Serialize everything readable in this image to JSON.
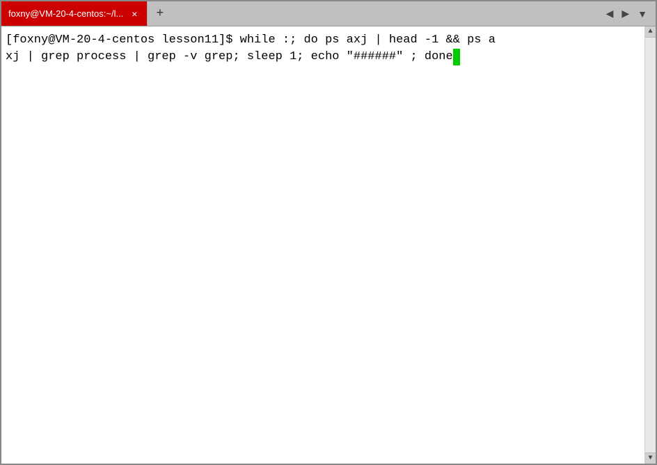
{
  "window": {
    "title": "foxny@VM-20-4-centos:~/l..."
  },
  "tab": {
    "label": "foxny@VM-20-4-centos:~/l...",
    "close_label": "×",
    "add_label": "+"
  },
  "nav": {
    "left_arrow": "◀",
    "right_arrow": "▶",
    "dropdown_arrow": "▼"
  },
  "terminal": {
    "line1": "[foxny@VM-20-4-centos lesson11]$ while :; do ps axj | head -1 && ps a",
    "line2": "xj | grep process | grep -v grep; sleep 1; echo \"######\" ; done",
    "cursor_char": " "
  },
  "scrollbar": {
    "up_arrow": "▲",
    "down_arrow": "▼"
  }
}
